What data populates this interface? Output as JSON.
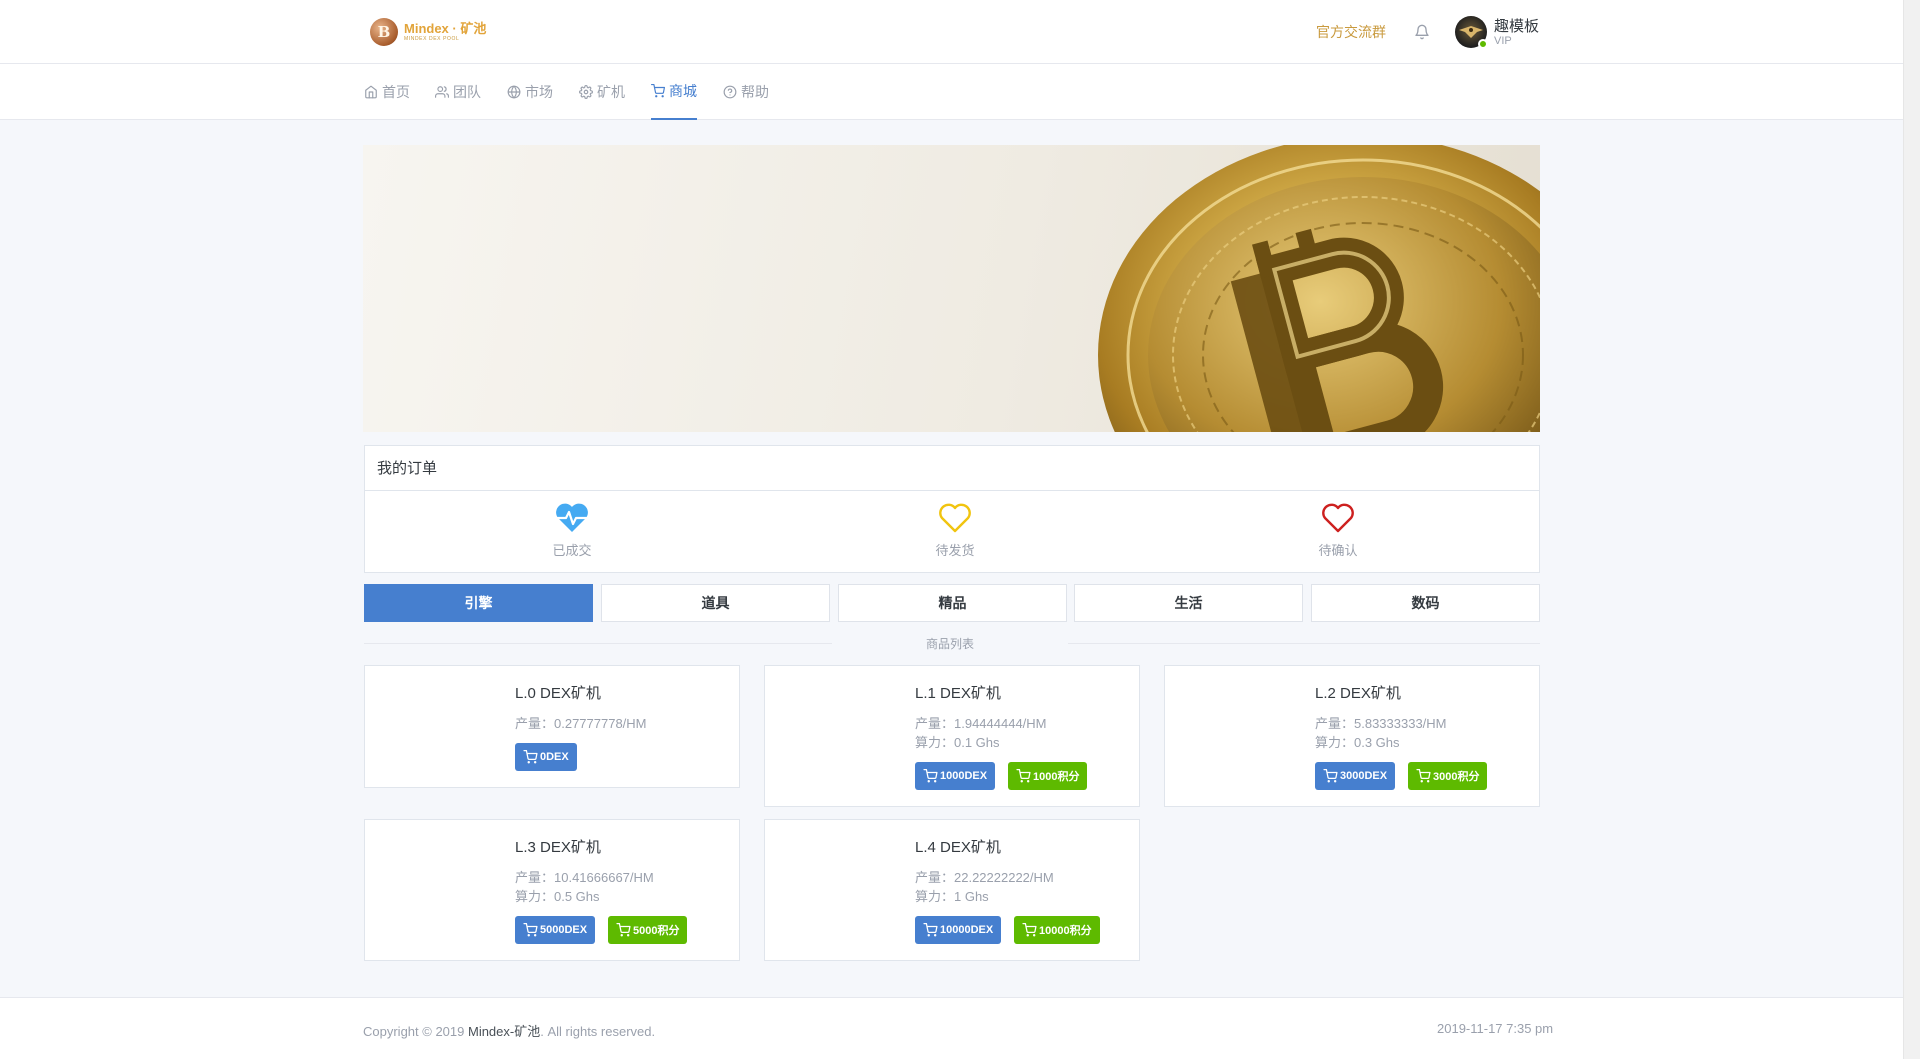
{
  "header": {
    "logo_title": "Mindex · 矿池",
    "logo_subtitle": "MINDEX DEX POOL",
    "group_link": "官方交流群",
    "user_name": "趣模板",
    "user_level": "VIP"
  },
  "nav": {
    "items": [
      {
        "label": "首页",
        "icon": "home-icon"
      },
      {
        "label": "团队",
        "icon": "users-icon"
      },
      {
        "label": "市场",
        "icon": "globe-icon"
      },
      {
        "label": "矿机",
        "icon": "chip-icon"
      },
      {
        "label": "商城",
        "icon": "cart-icon",
        "active": true
      },
      {
        "label": "帮助",
        "icon": "help-icon"
      }
    ]
  },
  "orders": {
    "title": "我的订单",
    "items": [
      {
        "label": "已成交",
        "icon": "heart-pulse-icon",
        "color": "#45aaf2"
      },
      {
        "label": "待发货",
        "icon": "heart-outline-icon",
        "color": "#f1c40f"
      },
      {
        "label": "待确认",
        "icon": "heart-outline-icon",
        "color": "#cd201f"
      }
    ]
  },
  "tabs": [
    "引擎",
    "道具",
    "精品",
    "生活",
    "数码"
  ],
  "list_title": "商品列表",
  "products": [
    {
      "name": "L.0 DEX矿机",
      "output": "产量：0.27777778/HM",
      "power": "",
      "price_dex": "0DEX",
      "price_points": ""
    },
    {
      "name": "L.1 DEX矿机",
      "output": "产量：1.94444444/HM",
      "power": "算力：0.1 Ghs",
      "price_dex": "1000DEX",
      "price_points": "1000积分"
    },
    {
      "name": "L.2 DEX矿机",
      "output": "产量：5.83333333/HM",
      "power": "算力：0.3 Ghs",
      "price_dex": "3000DEX",
      "price_points": "3000积分"
    },
    {
      "name": "L.3 DEX矿机",
      "output": "产量：10.41666667/HM",
      "power": "算力：0.5 Ghs",
      "price_dex": "5000DEX",
      "price_points": "5000积分"
    },
    {
      "name": "L.4 DEX矿机",
      "output": "产量：22.22222222/HM",
      "power": "算力：1 Ghs",
      "price_dex": "10000DEX",
      "price_points": "10000积分"
    }
  ],
  "footer": {
    "copyright_prefix": "Copyright © 2019 ",
    "brand": "Mindex-矿池",
    "copyright_suffix": ". All rights reserved.",
    "date": "2019-11-17 7:35 pm"
  },
  "colors": {
    "primary": "#467fcf",
    "success": "#5eba00",
    "gold": "#c99a3e"
  }
}
